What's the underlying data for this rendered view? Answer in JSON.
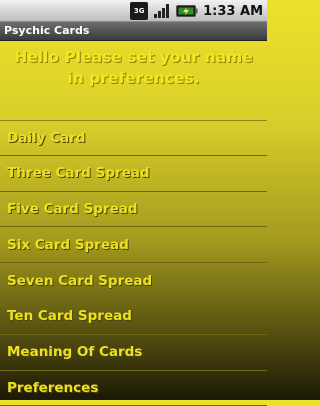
{
  "status_bar": {
    "network_type": "3G",
    "signal_icon": "signal-bars-icon",
    "battery_icon": "battery-charging-icon",
    "time": "1:33 AM"
  },
  "app": {
    "title": "Psychic Cards"
  },
  "greeting": {
    "line1": "Hello Please set your name",
    "line2": "in preferences."
  },
  "menu": {
    "items": [
      {
        "label": "Daily Card"
      },
      {
        "label": "Three Card Spread"
      },
      {
        "label": "Five Card Spread"
      },
      {
        "label": "Six Card Spread"
      },
      {
        "label": "Seven Card Spread"
      },
      {
        "label": "Ten Card Spread"
      },
      {
        "label": "Meaning Of Cards"
      },
      {
        "label": "Preferences"
      }
    ]
  },
  "colors": {
    "text_yellow": "#ece11f",
    "background_top": "#ede12a",
    "background_bottom": "#1b1905"
  }
}
